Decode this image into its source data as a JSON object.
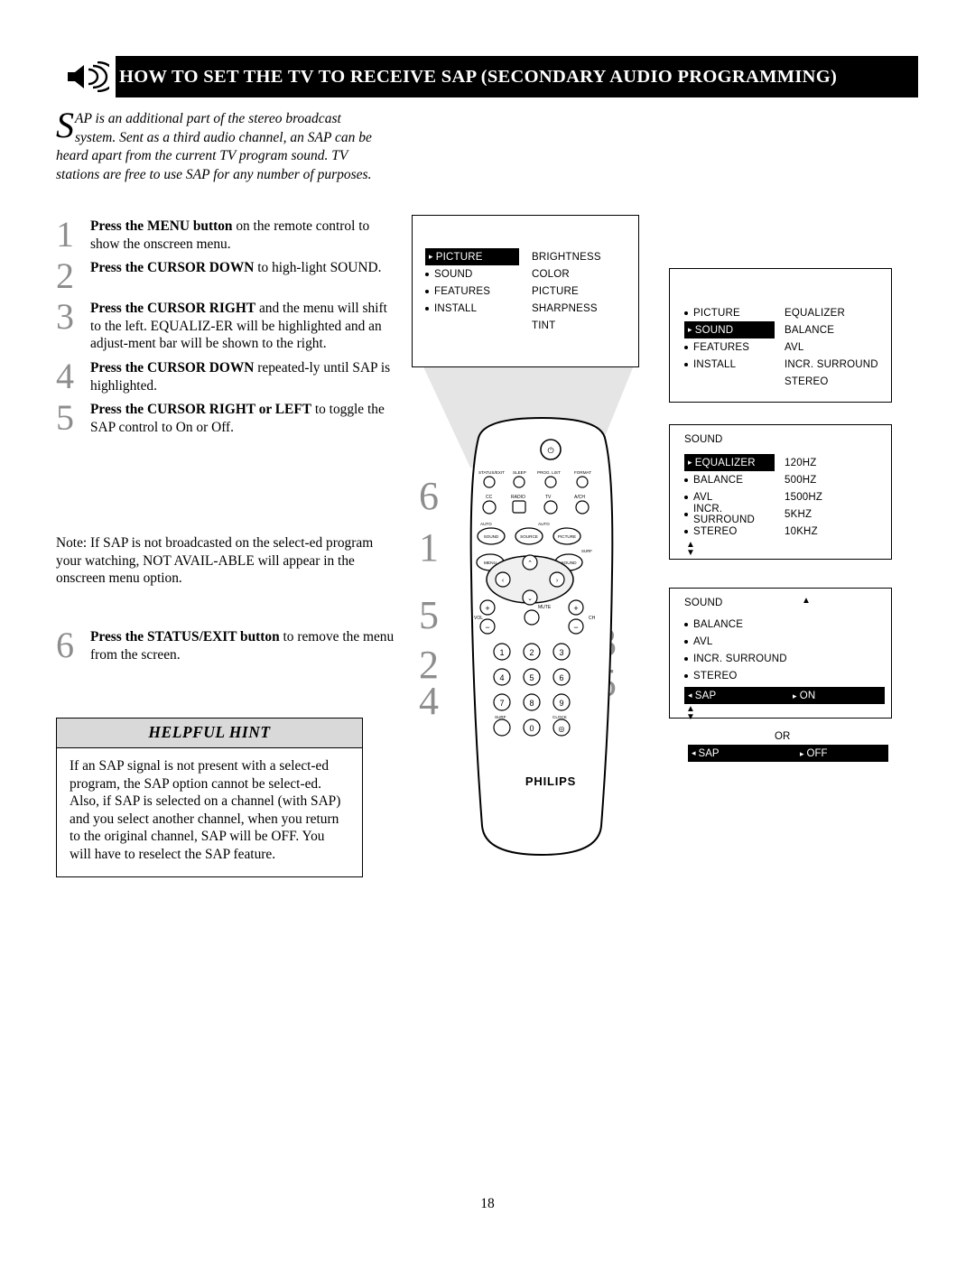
{
  "header": {
    "title_full": "HOW TO SET THE TV TO RECEIVE SAP (SECONDARY AUDIO PROGRAMMING)",
    "icon": "speaker-icon"
  },
  "intro": {
    "dropcap": "S",
    "text": "AP is an additional part of the stereo broadcast system.  Sent as a third audio channel, an SAP can be heard apart from the current TV program sound.  TV stations are free to use SAP for any number of purposes."
  },
  "steps": [
    {
      "num": "1",
      "bold": "Press the MENU button",
      "rest": " on the remote control to show the onscreen menu."
    },
    {
      "num": "2",
      "bold": "Press the CURSOR DOWN",
      "rest": " to high-light SOUND."
    },
    {
      "num": "3",
      "bold": "Press the CURSOR RIGHT",
      "rest": " and the menu will shift to the left. EQUALIZ-ER will be highlighted and an adjust-ment bar will be shown to the right."
    },
    {
      "num": "4",
      "bold": "Press the CURSOR DOWN",
      "rest": " repeated-ly until SAP is highlighted."
    },
    {
      "num": "5",
      "bold": "Press the CURSOR RIGHT or LEFT",
      "rest": " to toggle the SAP control to On or Off."
    },
    {
      "num": "6",
      "bold": "Press the STATUS/EXIT button",
      "rest": " to remove the menu from the screen."
    }
  ],
  "note": "Note: If SAP is not broadcasted on the select-ed program your watching, NOT AVAIL-ABLE will appear in the onscreen menu option.",
  "hint": {
    "title": "HELPFUL HINT",
    "body": "If an SAP signal is not present with a select-ed program, the SAP option cannot be select-ed.  Also, if SAP is selected on a channel (with SAP) and you select another channel, when you return to the original channel, SAP will be OFF.  You will have to reselect the SAP feature."
  },
  "osd": {
    "menu1": {
      "left": [
        "PICTURE",
        "SOUND",
        "FEATURES",
        "INSTALL"
      ],
      "right": [
        "BRIGHTNESS",
        "COLOR",
        "PICTURE",
        "SHARPNESS",
        "TINT"
      ],
      "highlighted": "PICTURE"
    },
    "menu2": {
      "left": [
        "PICTURE",
        "SOUND",
        "FEATURES",
        "INSTALL"
      ],
      "right": [
        "EQUALIZER",
        "BALANCE",
        "AVL",
        "INCR. SURROUND",
        "STEREO"
      ],
      "highlighted": "SOUND"
    },
    "menu3": {
      "title": "SOUND",
      "left": [
        "EQUALIZER",
        "BALANCE",
        "AVL",
        "INCR. SURROUND",
        "STEREO"
      ],
      "right": [
        "120HZ",
        "500HZ",
        "1500HZ",
        "5KHZ",
        "10KHZ"
      ],
      "highlighted": "EQUALIZER"
    },
    "menu4": {
      "title": "SOUND",
      "items": [
        "BALANCE",
        "AVL",
        "INCR. SURROUND",
        "STEREO"
      ],
      "sap_label": "SAP",
      "sap_value": "ON"
    },
    "or_label": "OR",
    "menu5": {
      "sap_label": "SAP",
      "sap_value": "OFF"
    }
  },
  "callouts": [
    "6",
    "1",
    "5",
    "2",
    "4",
    "3",
    "5"
  ],
  "remote": {
    "brand": "PHILIPS",
    "top_row": [
      "STATUS/EXIT",
      "SLEEP",
      "PROG. LIST",
      "FORMAT"
    ],
    "row2": [
      "CC",
      "RADIO",
      "TV",
      "A/CH"
    ],
    "row3": [
      "AUTO SOUND",
      "SOURCE",
      "AUTO PICTURE"
    ],
    "row4": [
      "MENU",
      "SURF",
      "SOUND"
    ],
    "vol_label": "VOL",
    "ch_label": "CH",
    "mute_label": "MUTE",
    "keypad": [
      "1",
      "2",
      "3",
      "4",
      "5",
      "6",
      "7",
      "8",
      "9",
      "0"
    ],
    "surf_label": "SURF",
    "clock_label": "CLOCK"
  },
  "page_number": "18"
}
